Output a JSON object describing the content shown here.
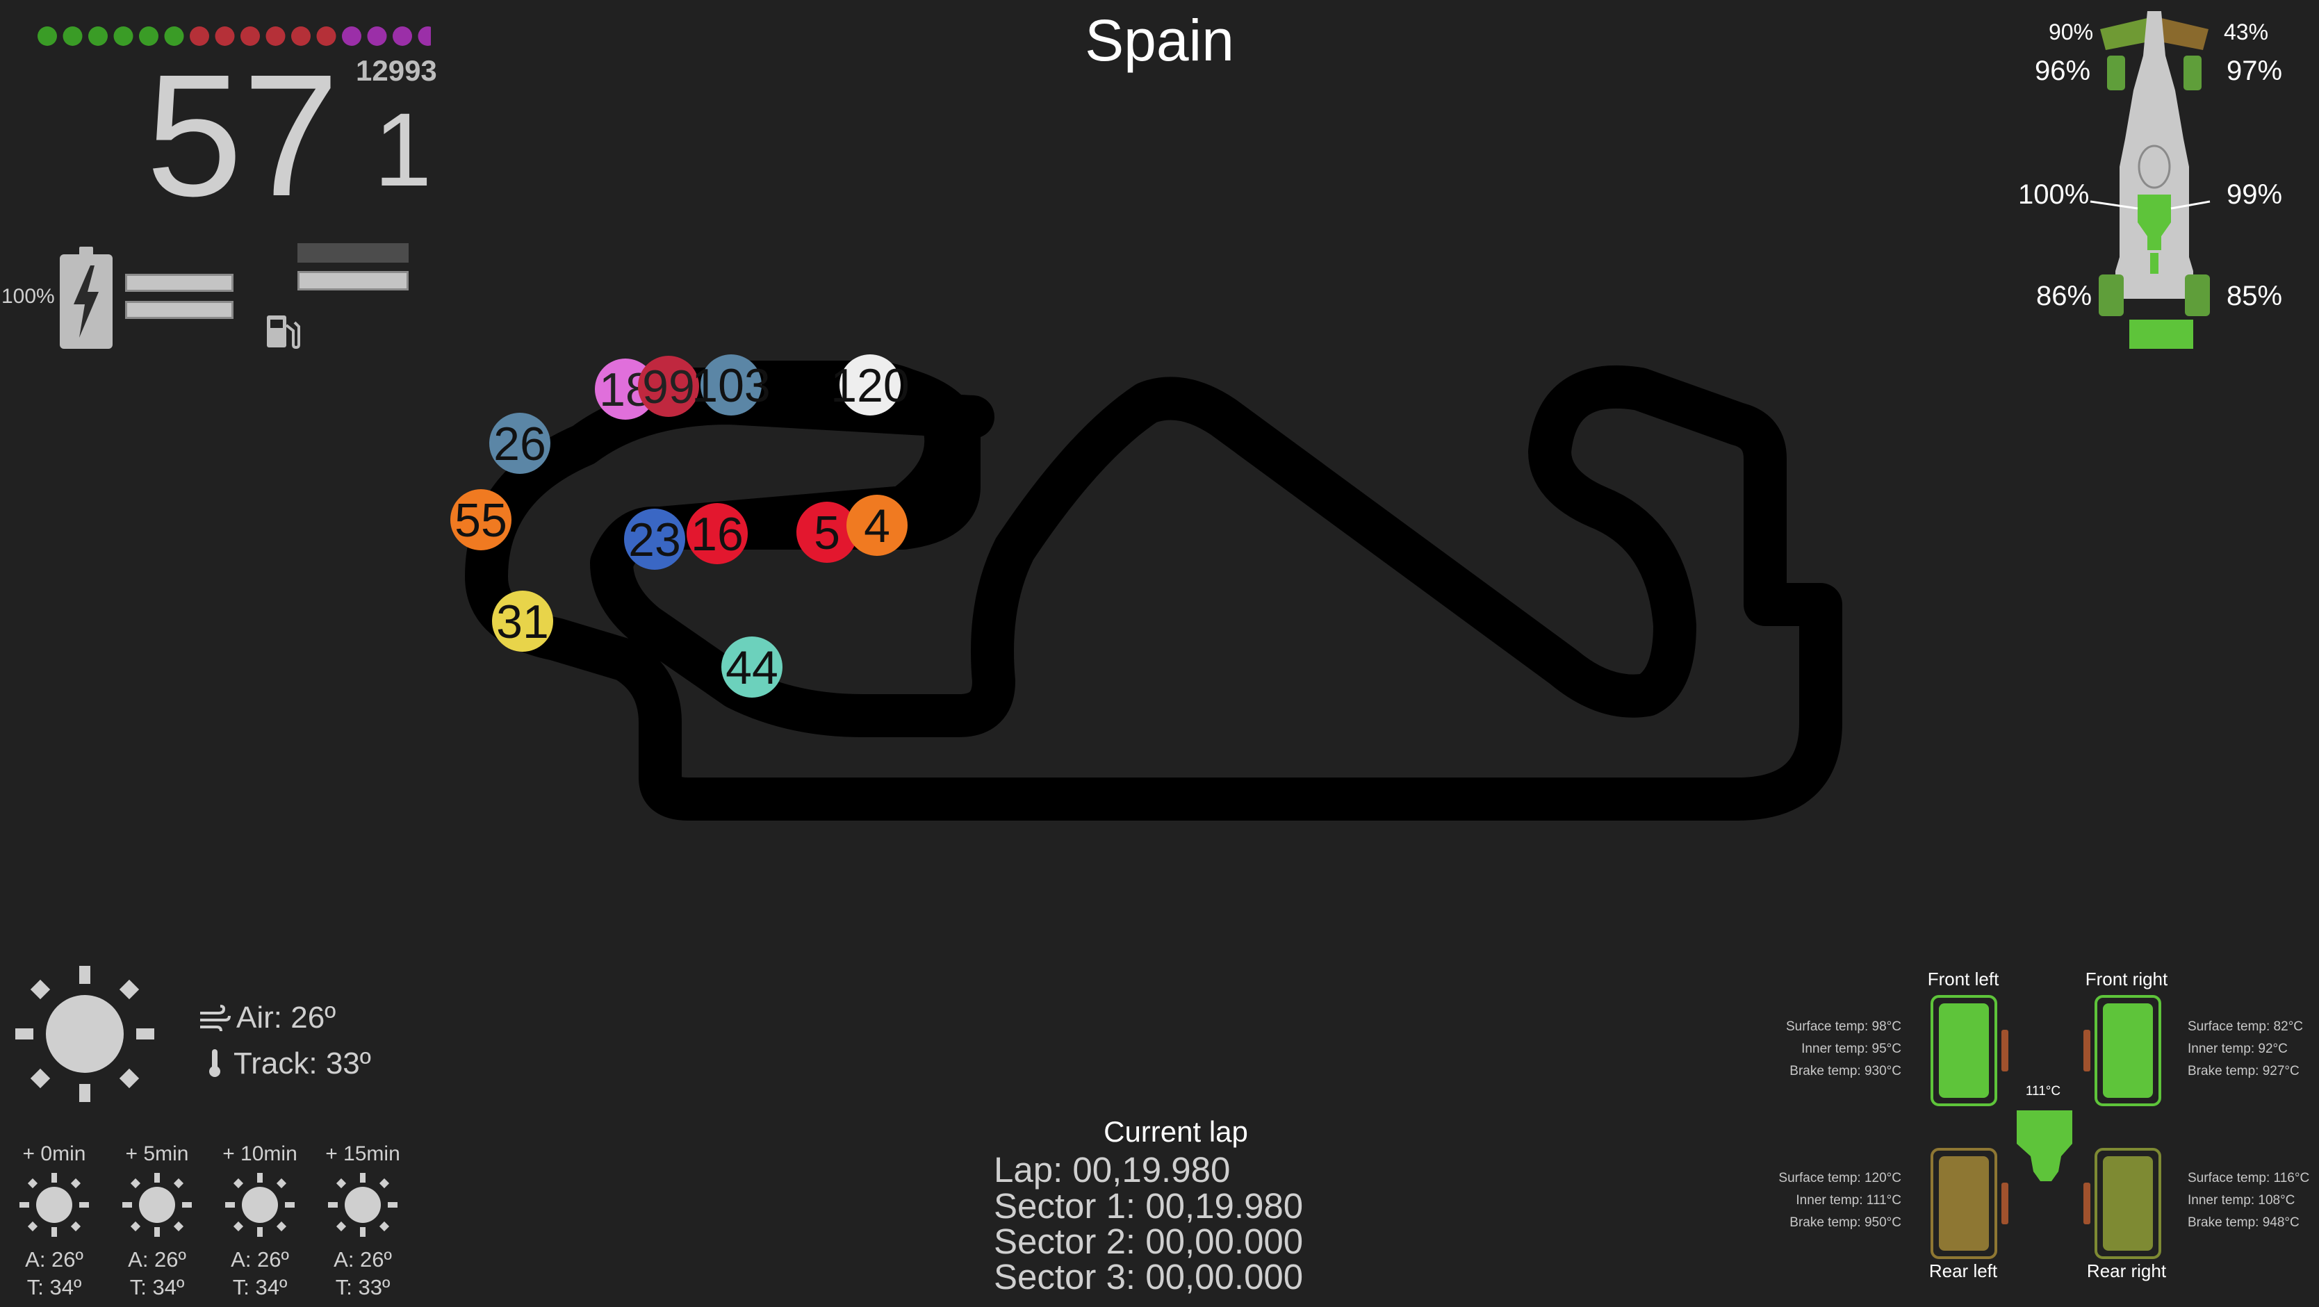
{
  "session": {
    "title": "Spain"
  },
  "telemetry": {
    "speed": "57",
    "gear": "1",
    "rpm": "12993",
    "ers_percent": "100%",
    "rev_lights": [
      "#3a9c26",
      "#3a9c26",
      "#3a9c26",
      "#3a9c26",
      "#3a9c26",
      "#3a9c26",
      "#b53038",
      "#b53038",
      "#b53038",
      "#b53038",
      "#b53038",
      "#b53038",
      "#9b2fa8",
      "#9b2fa8",
      "#9b2fa8",
      "#9b2fa8",
      "#c9c9c9"
    ]
  },
  "icons": {
    "battery": "battery-icon",
    "fuel": "fuel-pump-icon",
    "sun": "sun-icon",
    "wind": "wind-icon",
    "thermometer": "thermometer-icon"
  },
  "car_damage": {
    "front_wing_left": "90%",
    "front_wing_right": "43%",
    "tyre_front_left": "96%",
    "tyre_front_right": "97%",
    "floor_left": "100%",
    "floor_right": "99%",
    "tyre_rear_left": "86%",
    "tyre_rear_right": "85%"
  },
  "track": {
    "drivers": [
      {
        "number": "18",
        "color": "#e06fdb",
        "text": "#222222"
      },
      {
        "number": "99",
        "color": "#c0283f",
        "text": "#222222"
      },
      {
        "number": "103",
        "color": "#5b86a6",
        "text": "#111111"
      },
      {
        "number": "120",
        "color": "#eeeeee",
        "text": "#111111"
      },
      {
        "number": "26",
        "color": "#5b86a6",
        "text": "#111111"
      },
      {
        "number": "55",
        "color": "#f07a21",
        "text": "#111111"
      },
      {
        "number": "31",
        "color": "#e8d44a",
        "text": "#111111"
      },
      {
        "number": "23",
        "color": "#3a67c4",
        "text": "#111111"
      },
      {
        "number": "16",
        "color": "#e3172e",
        "text": "#111111"
      },
      {
        "number": "5",
        "color": "#e3172e",
        "text": "#111111"
      },
      {
        "number": "4",
        "color": "#f07a21",
        "text": "#111111"
      },
      {
        "number": "44",
        "color": "#6cd1bc",
        "text": "#111111"
      }
    ]
  },
  "weather": {
    "air": "Air: 26º",
    "track": "Track: 33º",
    "forecast": [
      {
        "label": "+ 0min",
        "air": "A: 26º",
        "track": "T: 34º"
      },
      {
        "label": "+ 5min",
        "air": "A: 26º",
        "track": "T: 34º"
      },
      {
        "label": "+ 10min",
        "air": "A: 26º",
        "track": "T: 34º"
      },
      {
        "label": "+ 15min",
        "air": "A: 26º",
        "track": "T: 33º"
      }
    ]
  },
  "lap": {
    "title": "Current lap",
    "lap": "Lap: 00,19.980",
    "sector1": "Sector 1: 00,19.980",
    "sector2": "Sector 2: 00,00.000",
    "sector3": "Sector 3: 00,00.000"
  },
  "tyres": {
    "engine_temp": "111°C",
    "front_left": {
      "label": "Front left",
      "surface": "Surface temp: 98°C",
      "inner": "Inner temp: 95°C",
      "brake": "Brake temp: 930°C",
      "color": "#5ec43a"
    },
    "front_right": {
      "label": "Front right",
      "surface": "Surface temp: 82°C",
      "inner": "Inner temp: 92°C",
      "brake": "Brake temp: 927°C",
      "color": "#5ec43a"
    },
    "rear_left": {
      "label": "Rear left",
      "surface": "Surface temp: 120°C",
      "inner": "Inner temp: 111°C",
      "brake": "Brake temp: 950°C",
      "color": "#8e7733"
    },
    "rear_right": {
      "label": "Rear right",
      "surface": "Surface temp: 116°C",
      "inner": "Inner temp: 108°C",
      "brake": "Brake temp: 948°C",
      "color": "#7e8a33"
    }
  }
}
